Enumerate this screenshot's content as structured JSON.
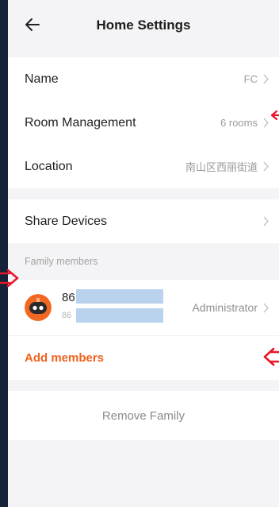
{
  "header": {
    "title": "Home Settings"
  },
  "settings": {
    "name": {
      "label": "Name",
      "value": "FC"
    },
    "room_management": {
      "label": "Room Management",
      "value": "6 rooms"
    },
    "location": {
      "label": "Location",
      "value": "南山区西丽街道"
    }
  },
  "share": {
    "label": "Share Devices"
  },
  "family": {
    "section_title": "Family members",
    "members": [
      {
        "name_prefix": "86",
        "sub_prefix": "86",
        "role": "Administrator"
      }
    ],
    "add_label": "Add members"
  },
  "remove": {
    "label": "Remove Family"
  },
  "colors": {
    "accent": "#f0621e",
    "annotation_arrow": "#e8162a",
    "redaction": "#b9d2ee",
    "page_bg": "#f4f4f6",
    "outer_bg": "#142338"
  },
  "icons": {
    "back": "arrow-left-icon",
    "chevron": "chevron-right-icon",
    "avatar": "robot-avatar-icon"
  }
}
